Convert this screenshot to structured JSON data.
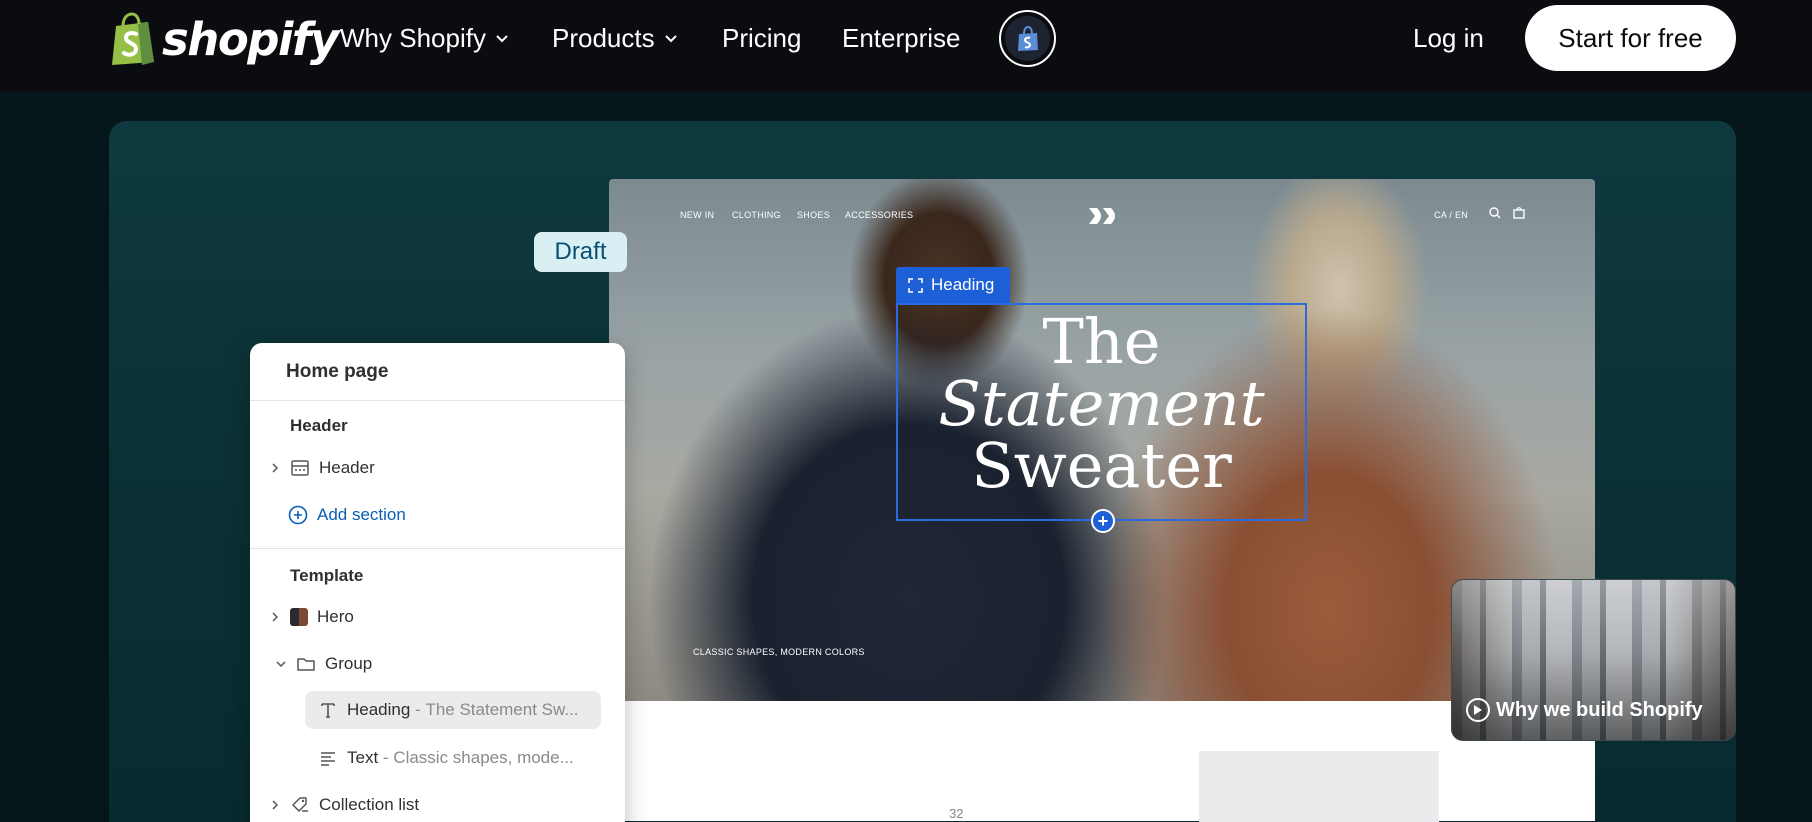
{
  "brand": {
    "name": "shopify",
    "logo_icon": "shopify-bag-icon",
    "logo_color": "#95bf47"
  },
  "nav": {
    "items": [
      {
        "label": "Why Shopify",
        "has_dropdown": true
      },
      {
        "label": "Products",
        "has_dropdown": true
      },
      {
        "label": "Pricing",
        "has_dropdown": false
      },
      {
        "label": "Enterprise",
        "has_dropdown": false
      }
    ],
    "shop_icon": "shop-app-icon",
    "login_label": "Log in",
    "cta_label": "Start for free"
  },
  "preview": {
    "store_nav": [
      "NEW IN",
      "CLOTHING",
      "SHOES",
      "ACCESSORIES"
    ],
    "locale": "CA / EN",
    "heading_tag": "Heading",
    "heading_lines": [
      "The",
      "Statement",
      "Sweater"
    ],
    "caption": "CLASSIC SHAPES, MODERN COLORS",
    "lower_number": "32",
    "accent_color": "#1c5fd6"
  },
  "draft_label": "Draft",
  "panel": {
    "title": "Home page",
    "header_section_label": "Header",
    "header_item": "Header",
    "add_section_label": "Add section",
    "template_section_label": "Template",
    "items": {
      "hero": "Hero",
      "group": "Group",
      "heading": "Heading",
      "heading_sub": "The Statement Sw...",
      "text": "Text",
      "text_sub": "Classic shapes, mode...",
      "collection": "Collection list"
    },
    "separator": " - "
  },
  "video": {
    "label": "Why we build Shopify"
  }
}
